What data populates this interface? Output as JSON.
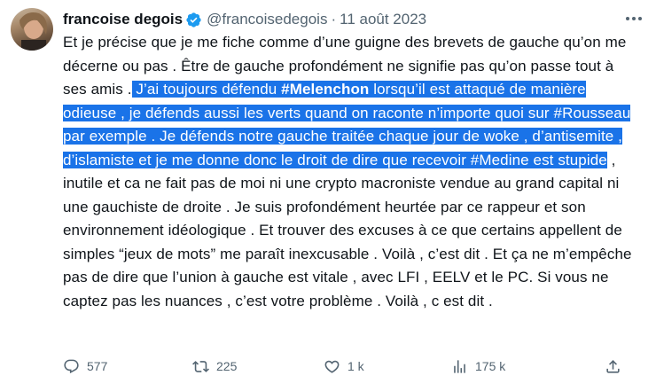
{
  "author": {
    "name": "francoise degois",
    "handle": "@francoisedegois",
    "separator": "·",
    "date": "11 août 2023"
  },
  "tweet": {
    "p1": "Et je précise que je me fiche comme d’une guigne des brevets de gauche qu’on me décerne ou pas . Être de gauche  profondément ne signifie pas qu’on passe tout à ses amis .",
    "h1": " J’ai toujours défendu ",
    "tag1": "#Melenchon",
    "h2": " lorsqu’il est  attaqué de manière odieuse , je défends aussi les verts quand on raconte n’importe quoi sur #Rousseau par exemple  . Je défends notre gauche traitée chaque jour de woke , d’antisemite ,  d’islamiste et je me donne donc le droit de dire que recevoir #Medine est stupide",
    "p2": " , inutile et ca ne fait pas de moi ni une crypto macroniste vendue au grand capital ni une gauchiste de droite . Je suis  profondément heurtée par ce rappeur et son environnement idéologique    . Et trouver des excuses à ce que certains appellent de  simples “jeux de mots” me paraît inexcusable . Voilà , c’est dit . Et  ça ne m’empêche pas de dire que l’union à gauche est vitale , avec LFI , EELV et le PC. Si vous ne captez pas les nuances , c’est votre problème . Voilà , c est dit ."
  },
  "actions": {
    "replies": "577",
    "retweets": "225",
    "likes": "1 k",
    "views": "175 k"
  },
  "colors": {
    "highlight": "#1a73e8",
    "secondary_text": "#536471",
    "verified": "#1d9bf0"
  },
  "icons": [
    "verified-badge-icon",
    "more-options-icon",
    "reply-icon",
    "retweet-icon",
    "like-icon",
    "views-icon",
    "share-icon"
  ]
}
